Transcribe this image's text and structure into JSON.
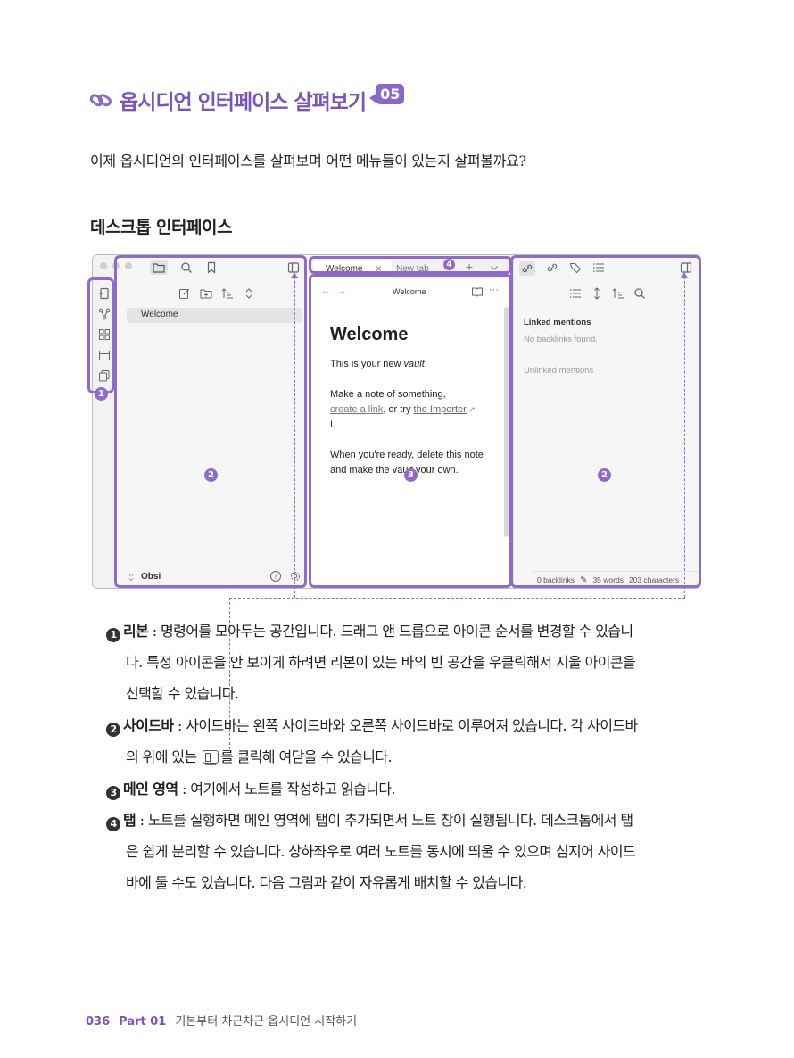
{
  "section": {
    "title": "옵시디언 인터페이스 살펴보기",
    "number": "05"
  },
  "intro": "이제 옵시디언의 인터페이스를 살펴보며 어떤 메뉴들이 있는지 살펴볼까요?",
  "subheading": "데스크톱 인터페이스",
  "app": {
    "tabs": [
      {
        "label": "Welcome"
      },
      {
        "label": "New tab"
      }
    ],
    "file_item": "Welcome",
    "vault_name": "Obsi",
    "note_header_title": "Welcome",
    "note": {
      "h1": "Welcome",
      "p1_prefix": "This is your new ",
      "p1_em": "vault",
      "p1_suffix": ".",
      "p2_a": "Make a note of something,",
      "p2_link1": "create a link",
      "p2_mid": ", or try ",
      "p2_link2": "the Importer",
      "p2_end": "!",
      "p3": "When you're ready, delete this note and make the vault your own."
    },
    "right": {
      "linked_mentions": "Linked mentions",
      "no_backlinks": "No backlinks found.",
      "unlinked_mentions": "Unlinked mentions"
    },
    "status": {
      "backlinks": "0 backlinks",
      "words": "35 words",
      "characters": "203 characters"
    },
    "callouts": [
      "1",
      "2",
      "3",
      "4",
      "2"
    ]
  },
  "items": [
    {
      "num": "1",
      "label": "리본",
      "lines": [
        " : 명령어를 모아두는 공간입니다. 드래그 앤 드롭으로 아이콘 순서를 변경할 수 있습니",
        "다. 특정 아이콘을 안 보이게 하려면 리본이 있는 바의 빈 공간을 우클릭해서 지울 아이콘을",
        "선택할 수 있습니다."
      ]
    },
    {
      "num": "2",
      "label": "사이드바",
      "lines": [
        " : 사이드바는 왼쪽 사이드바와 오른쪽 사이드바로 이루어져 있습니다. 각 사이드바"
      ],
      "line2_prefix": "의 위에 있는 ",
      "line2_suffix": "를 클릭해 여닫을 수 있습니다."
    },
    {
      "num": "3",
      "label": "메인 영역",
      "lines": [
        " : 여기에서 노트를 작성하고 읽습니다."
      ]
    },
    {
      "num": "4",
      "label": "탭",
      "lines": [
        " : 노트를 실행하면 메인 영역에 탭이 추가되면서 노트 창이 실행됩니다. 데스크톱에서 탭",
        "은 쉽게 분리할 수 있습니다. 상하좌우로 여러 노트를 동시에 띄울 수 있으며 심지어 사이드",
        "바에 둘 수도 있습니다. 다음 그림과 같이 자유롭게 배치할 수 있습니다."
      ]
    }
  ],
  "footer": {
    "page": "036",
    "part": "Part 01",
    "chapter": "기본부터 차근차근 옵시디언 시작하기"
  }
}
